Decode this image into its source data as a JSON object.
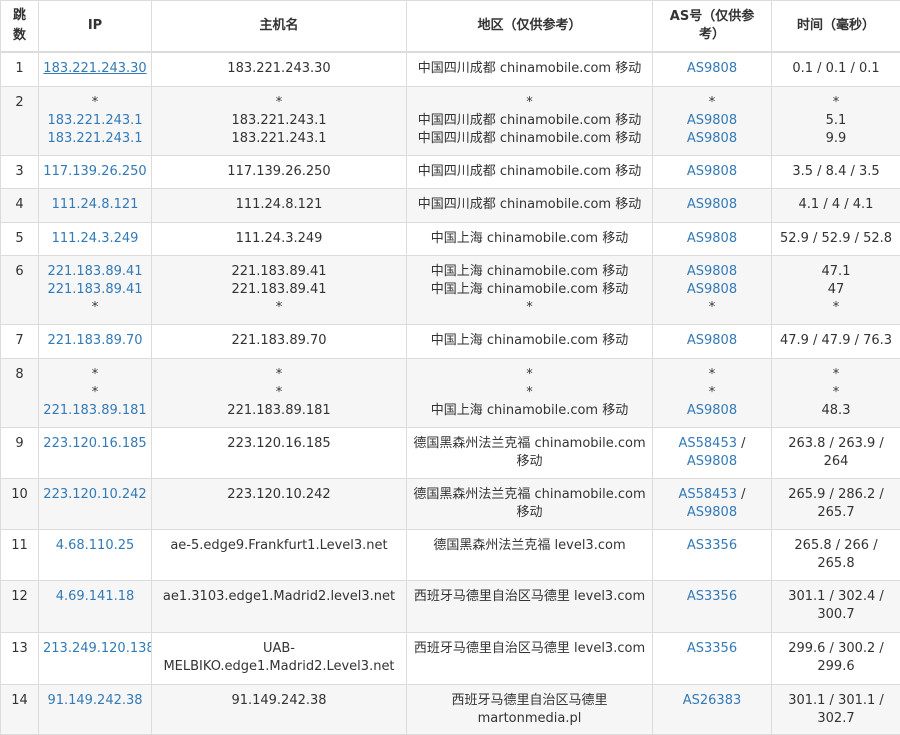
{
  "headers": {
    "hop": "跳数",
    "ip": "IP",
    "host": "主机名",
    "region": "地区（仅供参考）",
    "as": "AS号（仅供参考）",
    "time": "时间（毫秒）"
  },
  "rows": [
    {
      "hop": "1",
      "ip": [
        "183.221.243.30"
      ],
      "host": [
        "183.221.243.30"
      ],
      "region": [
        "中国四川成都 chinamobile.com 移动"
      ],
      "as": [
        "AS9808"
      ],
      "time": [
        "0.1 / 0.1 / 0.1"
      ]
    },
    {
      "hop": "2",
      "ip": [
        "*",
        "183.221.243.1",
        "183.221.243.1"
      ],
      "host": [
        "*",
        "183.221.243.1",
        "183.221.243.1"
      ],
      "region": [
        "*",
        "中国四川成都 chinamobile.com 移动",
        "中国四川成都 chinamobile.com 移动"
      ],
      "as": [
        "*",
        "AS9808",
        "AS9808"
      ],
      "time": [
        "*",
        "5.1",
        "9.9"
      ]
    },
    {
      "hop": "3",
      "ip": [
        "117.139.26.250"
      ],
      "host": [
        "117.139.26.250"
      ],
      "region": [
        "中国四川成都 chinamobile.com 移动"
      ],
      "as": [
        "AS9808"
      ],
      "time": [
        "3.5 / 8.4 / 3.5"
      ]
    },
    {
      "hop": "4",
      "ip": [
        "111.24.8.121"
      ],
      "host": [
        "111.24.8.121"
      ],
      "region": [
        "中国四川成都 chinamobile.com 移动"
      ],
      "as": [
        "AS9808"
      ],
      "time": [
        "4.1 / 4 / 4.1"
      ]
    },
    {
      "hop": "5",
      "ip": [
        "111.24.3.249"
      ],
      "host": [
        "111.24.3.249"
      ],
      "region": [
        "中国上海 chinamobile.com 移动"
      ],
      "as": [
        "AS9808"
      ],
      "time": [
        "52.9 / 52.9 / 52.8"
      ]
    },
    {
      "hop": "6",
      "ip": [
        "221.183.89.41",
        "221.183.89.41",
        "*"
      ],
      "host": [
        "221.183.89.41",
        "221.183.89.41",
        "*"
      ],
      "region": [
        "中国上海 chinamobile.com 移动",
        "中国上海 chinamobile.com 移动",
        "*"
      ],
      "as": [
        "AS9808",
        "AS9808",
        "*"
      ],
      "time": [
        "47.1",
        "47",
        "*"
      ]
    },
    {
      "hop": "7",
      "ip": [
        "221.183.89.70"
      ],
      "host": [
        "221.183.89.70"
      ],
      "region": [
        "中国上海 chinamobile.com 移动"
      ],
      "as": [
        "AS9808"
      ],
      "time": [
        "47.9 / 47.9 / 76.3"
      ]
    },
    {
      "hop": "8",
      "ip": [
        "*",
        "*",
        "221.183.89.181"
      ],
      "host": [
        "*",
        "*",
        "221.183.89.181"
      ],
      "region": [
        "*",
        "*",
        "中国上海 chinamobile.com 移动"
      ],
      "as": [
        "*",
        "*",
        "AS9808"
      ],
      "time": [
        "*",
        "*",
        "48.3"
      ]
    },
    {
      "hop": "9",
      "ip": [
        "223.120.16.185"
      ],
      "host": [
        "223.120.16.185"
      ],
      "region": [
        "德国黑森州法兰克福 chinamobile.com",
        "移动"
      ],
      "as": [
        "AS58453 /",
        "AS9808"
      ],
      "time": [
        "263.8 / 263.9 /",
        "264"
      ]
    },
    {
      "hop": "10",
      "ip": [
        "223.120.10.242"
      ],
      "host": [
        "223.120.10.242"
      ],
      "region": [
        "德国黑森州法兰克福 chinamobile.com",
        "移动"
      ],
      "as": [
        "AS58453 /",
        "AS9808"
      ],
      "time": [
        "265.9 / 286.2 /",
        "265.7"
      ]
    },
    {
      "hop": "11",
      "ip": [
        "4.68.110.25"
      ],
      "host": [
        "ae-5.edge9.Frankfurt1.Level3.net"
      ],
      "region": [
        "德国黑森州法兰克福 level3.com"
      ],
      "as": [
        "AS3356"
      ],
      "time": [
        "265.8 / 266 /",
        "265.8"
      ]
    },
    {
      "hop": "12",
      "ip": [
        "4.69.141.18"
      ],
      "host": [
        "ae1.3103.edge1.Madrid2.level3.net"
      ],
      "region": [
        "西班牙马德里自治区马德里 level3.com"
      ],
      "as": [
        "AS3356"
      ],
      "time": [
        "301.1 / 302.4 /",
        "300.7"
      ]
    },
    {
      "hop": "13",
      "ip": [
        "213.249.120.138"
      ],
      "host": [
        "UAB-",
        "MELBIKO.edge1.Madrid2.Level3.net"
      ],
      "region": [
        "西班牙马德里自治区马德里 level3.com"
      ],
      "as": [
        "AS3356"
      ],
      "time": [
        "299.6 / 300.2 /",
        "299.6"
      ]
    },
    {
      "hop": "14",
      "ip": [
        "91.149.242.38"
      ],
      "host": [
        "91.149.242.38"
      ],
      "region": [
        "西班牙马德里自治区马德里",
        "martonmedia.pl"
      ],
      "as": [
        "AS26383"
      ],
      "time": [
        "301.1 / 301.1 /",
        "302.7"
      ]
    }
  ],
  "colors": {
    "link": "#337ab7",
    "border": "#dcdcdc",
    "stripe": "#f6f6f6",
    "text": "#333333"
  }
}
